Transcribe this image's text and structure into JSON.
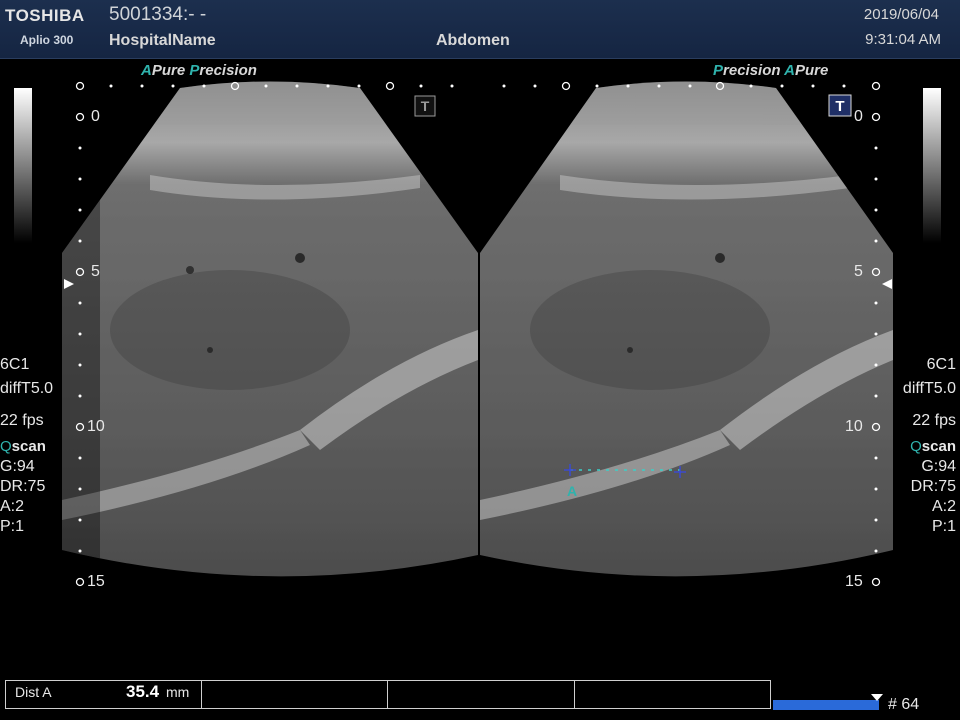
{
  "header": {
    "brand": "TOSHIBA",
    "model": "Aplio 300",
    "patient_id": "5001334:- -",
    "hospital": "HospitalName",
    "exam": "Abdomen",
    "date": "2019/06/04",
    "time": "9:31:04 AM"
  },
  "left_panel": {
    "brand_a": "A",
    "brand_pure": "Pure",
    "brand_p": "P",
    "brand_precision": "recision",
    "mode_badge": "T",
    "depth_labels": [
      "0",
      "5",
      "10",
      "15"
    ]
  },
  "right_panel": {
    "brand_p": "P",
    "brand_precision": "recision",
    "brand_a": "A",
    "brand_pure": "Pure",
    "mode_badge": "T",
    "depth_labels": [
      "0",
      "5",
      "10",
      "15"
    ],
    "caliper_label": "A"
  },
  "params_left": {
    "transducer": "6C1",
    "preset": "diffT5.0",
    "fps": "22 fps",
    "qscan_q": "Q",
    "qscan_rest": "scan",
    "gain": "G:94",
    "dr": "DR:75",
    "a": "A:2",
    "p": "P:1"
  },
  "params_right": {
    "transducer": "6C1",
    "preset": "diffT5.0",
    "fps": "22 fps",
    "qscan_q": "Q",
    "qscan_rest": "scan",
    "gain": "G:94",
    "dr": "DR:75",
    "a": "A:2",
    "p": "P:1"
  },
  "measurement": {
    "label": "Dist A",
    "value": "35.4",
    "unit": "mm"
  },
  "cine": {
    "frame_label": "# 64",
    "progress": 1.0
  },
  "colors": {
    "header_bg": "#1c2f4e",
    "accent_teal": "#2fb3ad",
    "caliper": "#3ad0c8",
    "cine_blue": "#2a6ad9"
  }
}
